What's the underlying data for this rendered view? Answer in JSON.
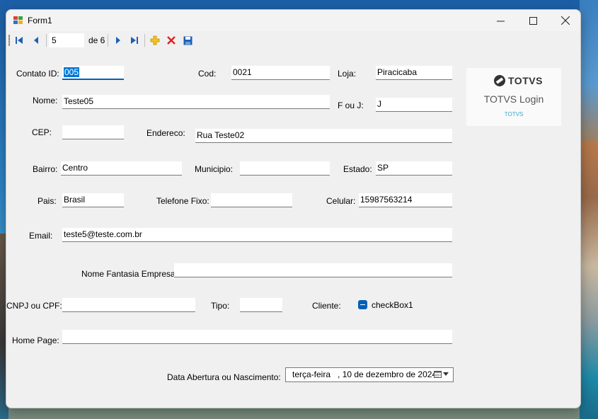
{
  "window": {
    "title": "Form1"
  },
  "navigator": {
    "position": "5",
    "of_label": "de 6"
  },
  "labels": {
    "contato_id": "Contato ID:",
    "cod": "Cod:",
    "loja": "Loja:",
    "nome": "Nome:",
    "f_ou_j": "F ou J:",
    "cep": "CEP:",
    "endereco": "Endereco:",
    "bairro": "Bairro:",
    "municipio": "Municipio:",
    "estado": "Estado:",
    "pais": "Pais:",
    "telefone_fixo": "Telefone Fixo:",
    "celular": "Celular:",
    "email": "Email:",
    "nome_fantasia": "Nome Fantasia Empresa:",
    "cnpj_cpf": "CNPJ ou CPF:",
    "tipo": "Tipo:",
    "cliente": "Cliente:",
    "home_page": "Home Page:",
    "data_abertura": "Data Abertura ou Nascimento:"
  },
  "fields": {
    "contato_id": "005",
    "cod": "0021",
    "loja": "Piracicaba",
    "nome": "Teste05",
    "f_ou_j": "J",
    "cep": "",
    "endereco": "Rua Teste02",
    "bairro": "Centro",
    "municipio": "",
    "estado": "SP",
    "pais": "Brasil",
    "telefone_fixo": "",
    "celular": "15987563214",
    "email": "teste5@teste.com.br",
    "nome_fantasia": "",
    "cnpj_cpf": "",
    "tipo": "",
    "home_page": ""
  },
  "checkbox": {
    "label": "checkBox1"
  },
  "date_picker": {
    "value": "terça-feira   , 10 de dezembro de 2024"
  },
  "login_panel": {
    "brand": "TOTVS",
    "title": "TOTVS Login",
    "subtitle": "TOTVS"
  },
  "colors": {
    "accent": "#005fb8",
    "selection": "#0078d7",
    "login_sub": "#3aa7c7"
  }
}
